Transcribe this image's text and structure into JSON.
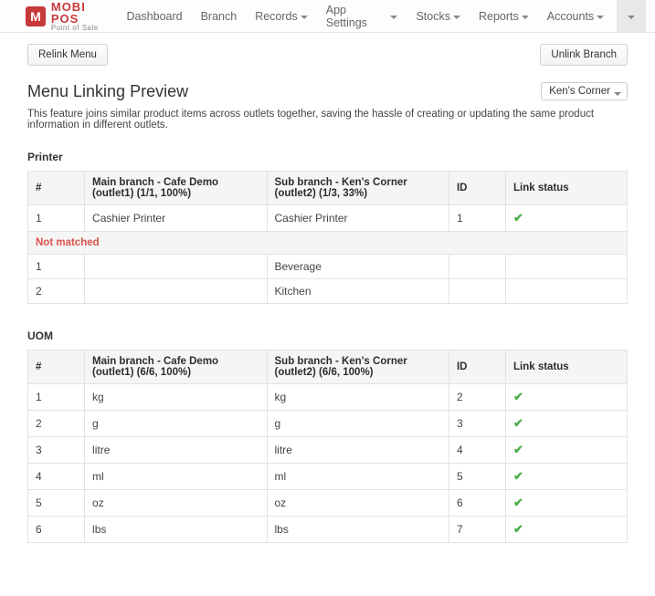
{
  "brand": {
    "logo_letter": "M",
    "title": "MOBI POS",
    "subtitle": "Point of Sale"
  },
  "nav": {
    "items": [
      {
        "label": "Dashboard",
        "dropdown": false
      },
      {
        "label": "Branch",
        "dropdown": false
      },
      {
        "label": "Records",
        "dropdown": true
      },
      {
        "label": "App Settings",
        "dropdown": true
      },
      {
        "label": "Stocks",
        "dropdown": true
      },
      {
        "label": "Reports",
        "dropdown": true
      },
      {
        "label": "Accounts",
        "dropdown": true
      }
    ]
  },
  "actions": {
    "relink_label": "Relink Menu",
    "unlink_label": "Unlink Branch"
  },
  "page_title": "Menu Linking Preview",
  "branch_select": {
    "value": "Ken's Corner"
  },
  "description": "This feature joins similar product items across outlets together, saving the hassle of creating or updating the same product information in different outlets.",
  "tables": {
    "printer": {
      "title": "Printer",
      "headers": {
        "num": "#",
        "main": "Main branch - Cafe Demo (outlet1) (1/1, 100%)",
        "sub": "Sub branch - Ken's Corner (outlet2) (1/3, 33%)",
        "id": "ID",
        "status": "Link status"
      },
      "matched": [
        {
          "num": "1",
          "main": "Cashier Printer",
          "sub": "Cashier Printer",
          "id": "1",
          "ok": true
        }
      ],
      "not_matched_label": "Not matched",
      "unmatched": [
        {
          "num": "1",
          "main": "",
          "sub": "Beverage",
          "id": "",
          "ok": false
        },
        {
          "num": "2",
          "main": "",
          "sub": "Kitchen",
          "id": "",
          "ok": false
        }
      ]
    },
    "uom": {
      "title": "UOM",
      "headers": {
        "num": "#",
        "main": "Main branch - Cafe Demo (outlet1) (6/6, 100%)",
        "sub": "Sub branch - Ken's Corner (outlet2) (6/6, 100%)",
        "id": "ID",
        "status": "Link status"
      },
      "rows": [
        {
          "num": "1",
          "main": "kg",
          "sub": "kg",
          "id": "2",
          "ok": true
        },
        {
          "num": "2",
          "main": "g",
          "sub": "g",
          "id": "3",
          "ok": true
        },
        {
          "num": "3",
          "main": "litre",
          "sub": "litre",
          "id": "4",
          "ok": true
        },
        {
          "num": "4",
          "main": "ml",
          "sub": "ml",
          "id": "5",
          "ok": true
        },
        {
          "num": "5",
          "main": "oz",
          "sub": "oz",
          "id": "6",
          "ok": true
        },
        {
          "num": "6",
          "main": "lbs",
          "sub": "lbs",
          "id": "7",
          "ok": true
        }
      ]
    }
  }
}
